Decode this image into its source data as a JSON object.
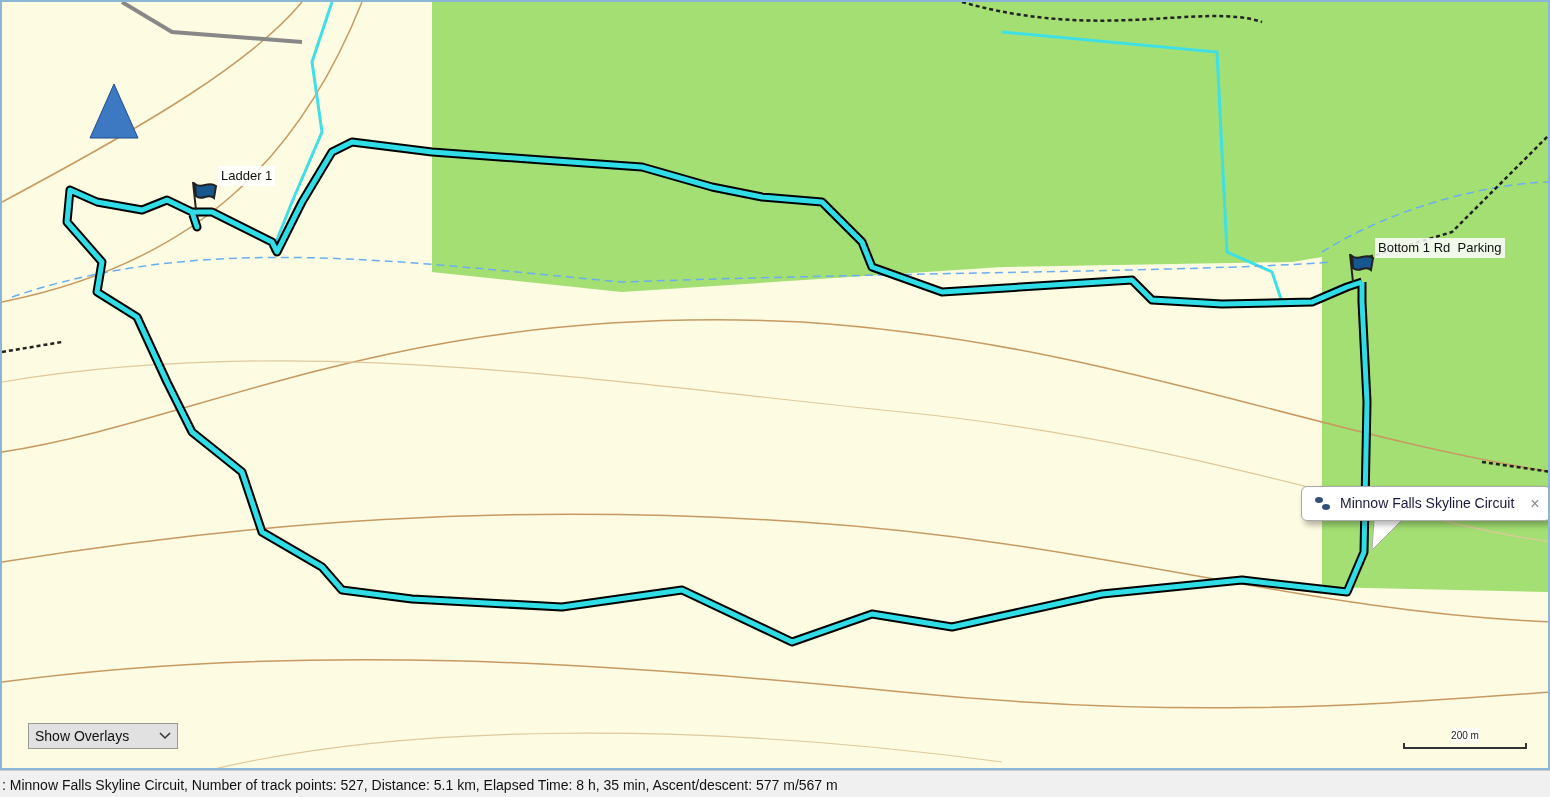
{
  "map": {
    "waypoints": [
      {
        "label": "Ladder 1"
      },
      {
        "label": "Bottom 1 Rd  Parking"
      }
    ],
    "popup": {
      "title": "Minnow Falls Skyline Circuit",
      "close": "×"
    },
    "overlay_dropdown": {
      "value": "Show Overlays"
    },
    "scale_bar": {
      "label": "200 m"
    }
  },
  "status_bar": {
    "text": ": Minnow Falls Skyline Circuit, Number of track points: 527, Distance: 5.1 km, Elapsed Time: 8 h, 35 min, Ascent/descent: 577 m/567 m"
  }
}
